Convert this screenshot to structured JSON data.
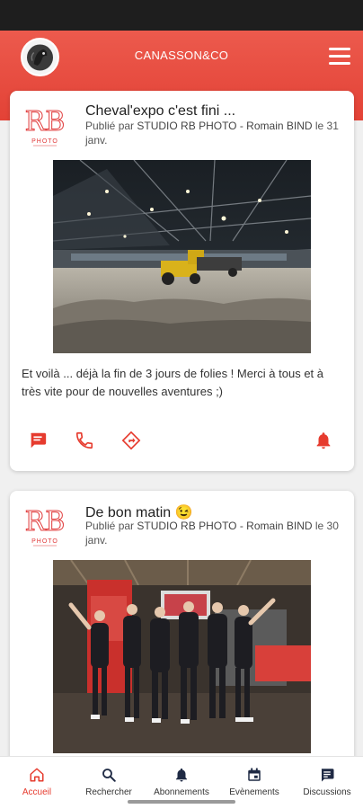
{
  "app": {
    "title": "CANASSON&CO"
  },
  "colors": {
    "brand": "#e8473a",
    "status_bar": "#1e1e1e",
    "background": "#f0f0f0"
  },
  "posts": [
    {
      "title": "Cheval'expo c'est fini ...",
      "meta_prefix": "Publié par",
      "author": "STUDIO RB PHOTO - Romain BIND",
      "meta_suffix": "le 31 janv.",
      "body": "Et voilà ... déjà la fin de 3 jours de folies ! Merci à tous et à très vite pour de nouvelles aventures ;)",
      "logo_letters": "RB",
      "logo_caption": "PHOTO",
      "actions": [
        "message-icon",
        "phone-icon",
        "directions-icon",
        "bell-icon"
      ]
    },
    {
      "title": "De bon matin 😉",
      "meta_prefix": "Publié par",
      "author": "STUDIO RB PHOTO - Romain BIND",
      "meta_suffix": "le 30 janv.",
      "logo_letters": "RB",
      "logo_caption": "PHOTO"
    }
  ],
  "nav": {
    "items": [
      {
        "label": "Accueil",
        "icon": "home-icon",
        "active": true
      },
      {
        "label": "Rechercher",
        "icon": "search-icon",
        "active": false
      },
      {
        "label": "Abonnements",
        "icon": "bell-icon",
        "active": false
      },
      {
        "label": "Evènements",
        "icon": "calendar-icon",
        "active": false
      },
      {
        "label": "Discussions",
        "icon": "chat-icon",
        "active": false
      }
    ]
  }
}
